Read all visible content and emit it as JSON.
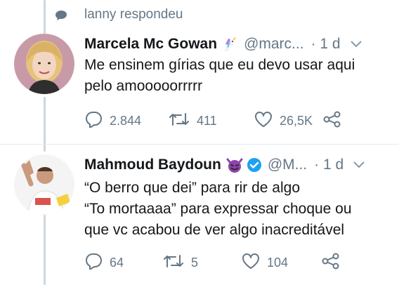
{
  "context": {
    "replied_text": "lanny respondeu"
  },
  "tweets": [
    {
      "author": "Marcela Mc Gowan",
      "name_emoji": "unicorn-emoji",
      "handle": "@marc...",
      "time": "· 1 d",
      "lines": [
        "Me ensinem gírias que eu devo usar aqui",
        "pelo amooooorrrrr"
      ],
      "replies": "2.844",
      "retweets": "411",
      "likes": "26,5K"
    },
    {
      "author": "Mahmoud Baydoun",
      "name_emoji": "smiling-devil-emoji",
      "verified": true,
      "handle": "@M...",
      "time": "· 1 d",
      "lines": [
        "“O berro que dei” para rir de algo",
        "“To mortaaaa” para expressar choque ou",
        "que vc acabou de ver algo inacreditável"
      ],
      "replies": "64",
      "retweets": "5",
      "likes": "104"
    }
  ],
  "colors": {
    "text": "#14171a",
    "muted": "#657786",
    "thread_line": "#ccd6dd",
    "divider": "#e6ecf0",
    "verified": "#1da1f2",
    "devil": "#8e44ad"
  }
}
